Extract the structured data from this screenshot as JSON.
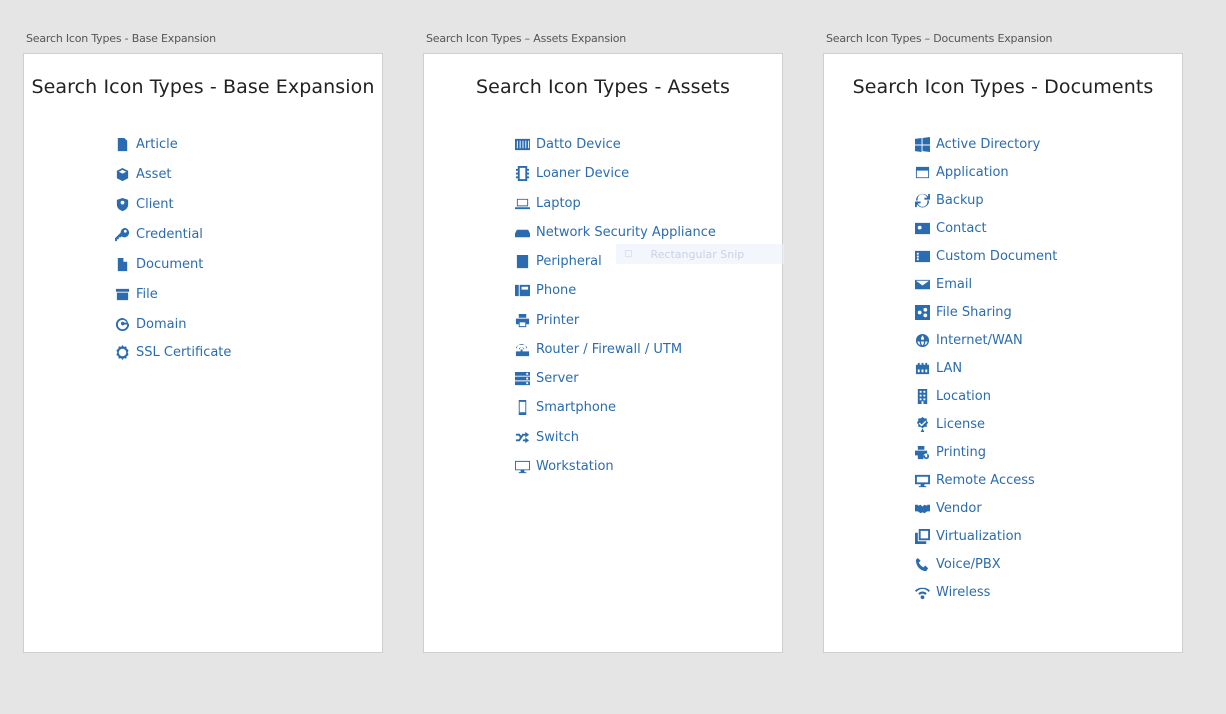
{
  "artboards": [
    {
      "label": "Search Icon Types - Base Expansion",
      "title": "Search Icon Types - Base Expansion",
      "items": [
        {
          "label": "Article",
          "icon": "article-icon"
        },
        {
          "label": "Asset",
          "icon": "asset-icon"
        },
        {
          "label": "Client",
          "icon": "client-icon"
        },
        {
          "label": "Credential",
          "icon": "credential-icon"
        },
        {
          "label": "Document",
          "icon": "document-icon"
        },
        {
          "label": "File",
          "icon": "file-icon"
        },
        {
          "label": "Domain",
          "icon": "domain-icon"
        },
        {
          "label": "SSL Certificate",
          "icon": "ssl-certificate-icon"
        }
      ]
    },
    {
      "label": "Search Icon Types – Assets Expansion",
      "title": "Search Icon Types - Assets",
      "items": [
        {
          "label": "Datto Device",
          "icon": "datto-device-icon"
        },
        {
          "label": "Loaner Device",
          "icon": "loaner-device-icon"
        },
        {
          "label": "Laptop",
          "icon": "laptop-icon"
        },
        {
          "label": "Network Security Appliance",
          "icon": "network-security-appliance-icon"
        },
        {
          "label": "Peripheral",
          "icon": "peripheral-icon"
        },
        {
          "label": "Phone",
          "icon": "phone-icon"
        },
        {
          "label": "Printer",
          "icon": "printer-icon"
        },
        {
          "label": "Router / Firewall / UTM",
          "icon": "router-icon"
        },
        {
          "label": "Server",
          "icon": "server-icon"
        },
        {
          "label": "Smartphone",
          "icon": "smartphone-icon"
        },
        {
          "label": "Switch",
          "icon": "switch-icon"
        },
        {
          "label": "Workstation",
          "icon": "workstation-icon"
        }
      ],
      "ghost_label": "Rectangular Snip"
    },
    {
      "label": "Search Icon Types – Documents Expansion",
      "title": "Search Icon Types - Documents",
      "items": [
        {
          "label": "Active Directory",
          "icon": "active-directory-icon"
        },
        {
          "label": "Application",
          "icon": "application-icon"
        },
        {
          "label": "Backup",
          "icon": "backup-icon"
        },
        {
          "label": "Contact",
          "icon": "contact-icon"
        },
        {
          "label": "Custom Document",
          "icon": "custom-document-icon"
        },
        {
          "label": "Email",
          "icon": "email-icon"
        },
        {
          "label": "File Sharing",
          "icon": "file-sharing-icon"
        },
        {
          "label": "Internet/WAN",
          "icon": "internet-wan-icon"
        },
        {
          "label": "LAN",
          "icon": "lan-icon"
        },
        {
          "label": "Location",
          "icon": "location-icon"
        },
        {
          "label": "License",
          "icon": "license-icon"
        },
        {
          "label": "Printing",
          "icon": "printing-icon"
        },
        {
          "label": "Remote Access",
          "icon": "remote-access-icon"
        },
        {
          "label": "Vendor",
          "icon": "vendor-icon"
        },
        {
          "label": "Virtualization",
          "icon": "virtualization-icon"
        },
        {
          "label": "Voice/PBX",
          "icon": "voice-pbx-icon"
        },
        {
          "label": "Wireless",
          "icon": "wireless-icon"
        }
      ]
    }
  ],
  "colors": {
    "link": "#2b6cb0",
    "background": "#e5e5e5",
    "card": "#ffffff"
  }
}
